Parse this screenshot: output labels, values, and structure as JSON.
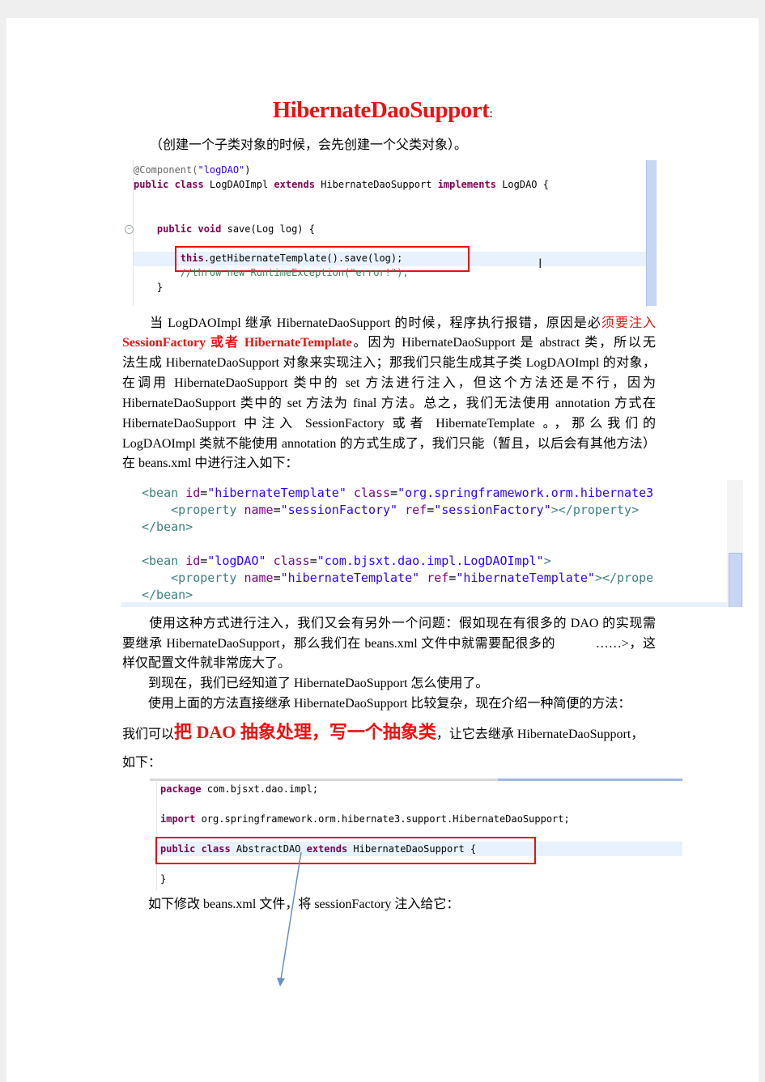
{
  "title": {
    "text": "HibernateDaoSupport",
    "colon": ":"
  },
  "subtitle": "（创建一个子类对象的时候，会先创建一个父类对象）。",
  "code1": {
    "lines": [
      [
        [
          "@Component(",
          "ann"
        ],
        [
          "\"logDAO\"",
          "str"
        ],
        [
          ")",
          ""
        ]
      ],
      [
        [
          "public class ",
          "kw"
        ],
        [
          "LogDAOImpl ",
          ""
        ],
        [
          "extends ",
          "kw"
        ],
        [
          "HibernateDaoSupport ",
          ""
        ],
        [
          "implements ",
          "kw"
        ],
        [
          "LogDAO {",
          ""
        ]
      ],
      [
        [
          "    public void ",
          "kw"
        ],
        [
          "save(Log log) {",
          ""
        ]
      ],
      [
        [
          "        this",
          "kw"
        ],
        [
          ".getHibernateTemplate().save(log);",
          ""
        ]
      ],
      [
        [
          "        //throw new RuntimeException(\"error!\");",
          "cm"
        ]
      ],
      [
        [
          "    }",
          ""
        ]
      ]
    ]
  },
  "para1": [
    [
      [
        "　　当 LogDAOImpl 继承 HibernateDaoSupport 的时候，程序执行报错，原因是必",
        ""
      ],
      [
        "须要注入",
        "red"
      ]
    ],
    [
      [
        "SessionFactory 或者 HibernateTemplate",
        "redb"
      ],
      [
        "。因为 HibernateDaoSupport 是 abstract 类，所以无",
        ""
      ]
    ],
    [
      [
        "法生成 HibernateDaoSupport 对象来实现注入；那我们只能生成其子类 LogDAOImpl 的对象，",
        ""
      ]
    ],
    [
      [
        "在调用 HibernateDaoSupport 类中的 set 方法进行注入，但这个方法还是不行，因为",
        ""
      ]
    ],
    [
      [
        "HibernateDaoSupport 类中的 set 方法为 final 方法。总之，我们无法使用 annotation 方式在",
        ""
      ]
    ],
    [
      [
        "HibernateDaoSupport 中注入 SessionFactory 或者 HibernateTemplate 。，那么我们的",
        ""
      ]
    ],
    [
      [
        "LogDAOImpl 类就不能使用 annotation 的方式生成了，我们只能（暂且，以后会有其他方法）",
        ""
      ]
    ],
    [
      [
        "在 beans.xml 中进行注入如下：",
        ""
      ]
    ]
  ],
  "code2": {
    "lines": [
      [
        [
          "<bean ",
          "tag"
        ],
        [
          "id",
          "attr"
        ],
        [
          "=",
          ""
        ],
        [
          "\"hibernateTemplate\" ",
          "xstr"
        ],
        [
          "class",
          "attr"
        ],
        [
          "=",
          ""
        ],
        [
          "\"org.springframework.orm.hibernate3",
          "xstr"
        ]
      ],
      [
        [
          "    <property ",
          "tag"
        ],
        [
          "name",
          "attr"
        ],
        [
          "=",
          ""
        ],
        [
          "\"sessionFactory\" ",
          "xstr"
        ],
        [
          "ref",
          "attr"
        ],
        [
          "=",
          ""
        ],
        [
          "\"sessionFactory\"",
          "xstr"
        ],
        [
          "></property>",
          "tag"
        ]
      ],
      [
        [
          "</bean>",
          "tag"
        ]
      ],
      [
        [
          "<bean ",
          "tag"
        ],
        [
          "id",
          "attr"
        ],
        [
          "=",
          ""
        ],
        [
          "\"logDAO\" ",
          "xstr"
        ],
        [
          "class",
          "attr"
        ],
        [
          "=",
          ""
        ],
        [
          "\"com.bjsxt.dao.impl.LogDAOImpl\"",
          "xstr"
        ],
        [
          ">",
          "tag"
        ]
      ],
      [
        [
          "    <property ",
          "tag"
        ],
        [
          "name",
          "attr"
        ],
        [
          "=",
          ""
        ],
        [
          "\"hibernateTemplate\" ",
          "xstr"
        ],
        [
          "ref",
          "attr"
        ],
        [
          "=",
          ""
        ],
        [
          "\"hibernateTemplate\"",
          "xstr"
        ],
        [
          "></prope",
          "tag"
        ]
      ],
      [
        [
          "</bean>",
          "tag"
        ]
      ]
    ]
  },
  "para2": [
    [
      [
        "　　使用这种方式进行注入，我们又会有另外一个问题：假如现在有很多的 DAO 的实现需",
        ""
      ]
    ],
    [
      [
        "要继承 HibernateDaoSupport，那么我们在 beans.xml 文件中就需要配很多的　　　……>，这",
        ""
      ]
    ],
    [
      [
        "样仅配置文件就非常庞大了。",
        ""
      ]
    ],
    [
      [
        "　　到现在，我们已经知道了 HibernateDaoSupport 怎么使用了。",
        ""
      ]
    ],
    [
      [
        "　　使用上面的方法直接继承 HibernateDaoSupport 比较复杂，现在介绍一种简便的方法：",
        ""
      ]
    ]
  ],
  "para3": [
    [
      [
        "我们可以",
        ""
      ],
      [
        "把 DAO 抽象处理，写一个抽象类",
        "big"
      ],
      [
        "，让它去继承 HibernateDaoSupport，",
        ""
      ]
    ],
    [
      [
        "如下：",
        ""
      ]
    ]
  ],
  "code3": {
    "lines": [
      [
        [
          "package ",
          "kw"
        ],
        [
          "com.bjsxt.dao.impl;",
          ""
        ]
      ],
      [
        [
          "import ",
          "kw"
        ],
        [
          "org.springframework.orm.hibernate3.support.HibernateDaoSupport;",
          ""
        ]
      ],
      [
        [
          "public class ",
          "kw"
        ],
        [
          "AbstractDAO ",
          ""
        ],
        [
          "extends ",
          "kw"
        ],
        [
          "HibernateDaoSupport {",
          ""
        ]
      ],
      [
        [
          "}",
          ""
        ]
      ]
    ]
  },
  "para4": [
    [
      [
        "　　如下修改 beans.xml 文件，将 sessionFactory 注入给它：",
        ""
      ]
    ]
  ]
}
